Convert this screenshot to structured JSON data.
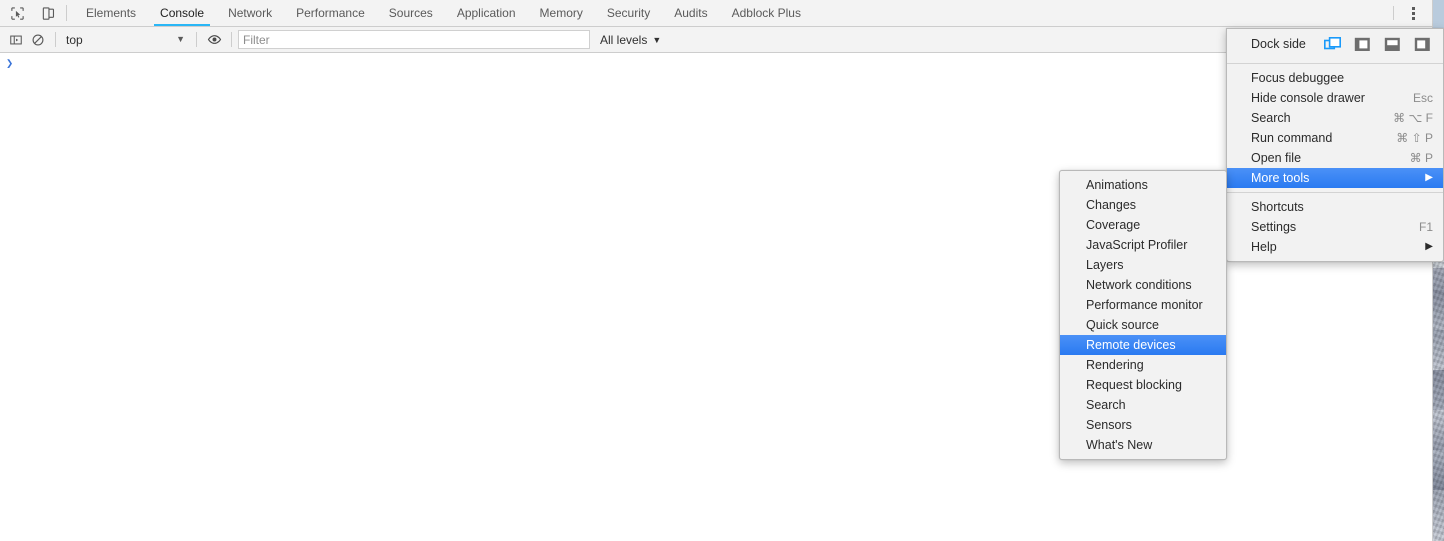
{
  "window": {
    "title": "Chrome DevTools"
  },
  "tabbar": {
    "inspect_icon": "inspect-cursor-icon",
    "device_toolbar_icon": "device-toolbar-icon",
    "tabs": [
      {
        "label": "Elements",
        "selected": false
      },
      {
        "label": "Console",
        "selected": true
      },
      {
        "label": "Network",
        "selected": false
      },
      {
        "label": "Performance",
        "selected": false
      },
      {
        "label": "Sources",
        "selected": false
      },
      {
        "label": "Application",
        "selected": false
      },
      {
        "label": "Memory",
        "selected": false
      },
      {
        "label": "Security",
        "selected": false
      },
      {
        "label": "Audits",
        "selected": false
      },
      {
        "label": "Adblock Plus",
        "selected": false
      }
    ],
    "more_options_icon": "kebab-menu-icon"
  },
  "filterbar": {
    "sidebar_toggle_icon": "console-sidebar-icon",
    "clear_console_icon": "clear-console-icon",
    "context_value": "top",
    "context_caret": "▼",
    "live_expression_icon": "eye-icon",
    "filter_value": "",
    "filter_placeholder": "Filter",
    "levels_label": "All levels",
    "levels_caret": "▼"
  },
  "console": {
    "prompt_symbol": "❯",
    "entries": []
  },
  "main_menu": {
    "dock_side": {
      "label": "Dock side",
      "options": [
        {
          "name": "undock-into-separate-window-icon",
          "selected": true
        },
        {
          "name": "dock-to-left-icon",
          "selected": false
        },
        {
          "name": "dock-to-bottom-icon",
          "selected": false
        },
        {
          "name": "dock-to-right-icon",
          "selected": false
        }
      ],
      "selected_color": "#1a9afa",
      "unselected_color": "#6e6e6e"
    },
    "groups": [
      [
        {
          "label": "Focus debuggee",
          "accel": "",
          "submenu": false,
          "highlight": false
        },
        {
          "label": "Hide console drawer",
          "accel": "Esc",
          "submenu": false,
          "highlight": false
        },
        {
          "label": "Search",
          "accel": "⌘ ⌥ F",
          "submenu": false,
          "highlight": false
        },
        {
          "label": "Run command",
          "accel": "⌘ ⇧ P",
          "submenu": false,
          "highlight": false
        },
        {
          "label": "Open file",
          "accel": "⌘ P",
          "submenu": false,
          "highlight": false
        },
        {
          "label": "More tools",
          "accel": "",
          "submenu": true,
          "highlight": true
        }
      ],
      [
        {
          "label": "Shortcuts",
          "accel": "",
          "submenu": false,
          "highlight": false
        },
        {
          "label": "Settings",
          "accel": "F1",
          "submenu": false,
          "highlight": false
        },
        {
          "label": "Help",
          "accel": "",
          "submenu": true,
          "highlight": false
        }
      ]
    ],
    "submenu_arrow": "▶",
    "highlight_color": "#2a7af1"
  },
  "more_tools_menu": {
    "items": [
      {
        "label": "Animations",
        "highlight": false
      },
      {
        "label": "Changes",
        "highlight": false
      },
      {
        "label": "Coverage",
        "highlight": false
      },
      {
        "label": "JavaScript Profiler",
        "highlight": false
      },
      {
        "label": "Layers",
        "highlight": false
      },
      {
        "label": "Network conditions",
        "highlight": false
      },
      {
        "label": "Performance monitor",
        "highlight": false
      },
      {
        "label": "Quick source",
        "highlight": false
      },
      {
        "label": "Remote devices",
        "highlight": true
      },
      {
        "label": "Rendering",
        "highlight": false
      },
      {
        "label": "Request blocking",
        "highlight": false
      },
      {
        "label": "Search",
        "highlight": false
      },
      {
        "label": "Sensors",
        "highlight": false
      },
      {
        "label": "What's New",
        "highlight": false
      }
    ]
  },
  "colors": {
    "accent_tab_underline": "#29b6f6",
    "menu_highlight": "#2a7af1",
    "toolbar_bg": "#f3f3f3",
    "menu_bg": "#f2f2f2",
    "prompt_arrow": "#3a74d8"
  }
}
